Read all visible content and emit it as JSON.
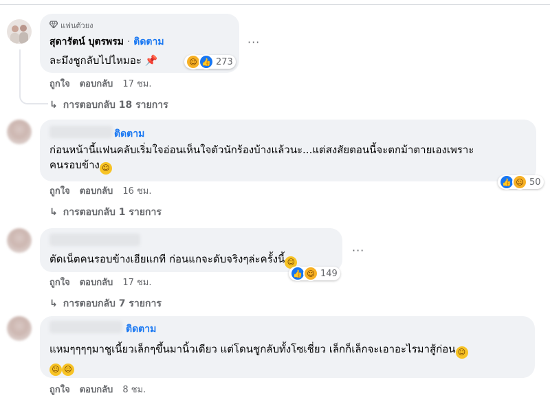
{
  "comments": [
    {
      "badge": "แฟนตัวยง",
      "author": "สุดารัตน์ บุตรพรม",
      "separator": "·",
      "follow": "ติดตาม",
      "text": "ละมึงชูกลับไปไหมอะ",
      "text_emoji": "📌",
      "reactions": {
        "count": "273"
      },
      "actions": {
        "like": "ถูกใจ",
        "reply": "ตอบกลับ",
        "time": "17 ชม."
      },
      "replies": "การตอบกลับ 18 รายการ",
      "more": "···"
    },
    {
      "follow": "ติดตาม",
      "text_line1": "ก่อนหน้านี้แฟนคลับเริ่มใจอ่อนเห็นใจตัวนักร้องบ้างแล้วนะ...แต่สงสัยตอนนี้จะตกม้าตายเองเพราะ",
      "text_line2": "คนรอบข้าง",
      "reactions": {
        "count": "50"
      },
      "actions": {
        "like": "ถูกใจ",
        "reply": "ตอบกลับ",
        "time": "16 ชม."
      },
      "replies": "การตอบกลับ 1 รายการ"
    },
    {
      "text": "ตัดเน็ตคนรอบข้างเฮียแกที ก่อนแกจะดับจริงๆล่ะครั้งนี้",
      "reactions": {
        "count": "149"
      },
      "actions": {
        "like": "ถูกใจ",
        "reply": "ตอบกลับ",
        "time": "17 ชม."
      },
      "replies": "การตอบกลับ 7 รายการ",
      "more": "···"
    },
    {
      "follow": "ติดตาม",
      "text_line1": "แหมๆๆๆๆมาชูเนี้ยวเล็กๆขึ้นมานิ้วเดียว แต่โดนชูกลับทั้งโซเชี่ยว เล็กก็เล็กจะเอาอะไรมาสู้ก่อน",
      "actions": {
        "like": "ถูกใจ",
        "reply": "ตอบกลับ",
        "time": "8 ชม."
      }
    }
  ],
  "icons": {
    "badge": "diamond-icon",
    "reply_arrow": "reply-arrow-icon",
    "like": "like-reaction-icon",
    "haha": "haha-reaction-icon"
  },
  "colors": {
    "follow": "#1877f2",
    "bubble": "#f0f2f5",
    "meta": "#65676b"
  }
}
